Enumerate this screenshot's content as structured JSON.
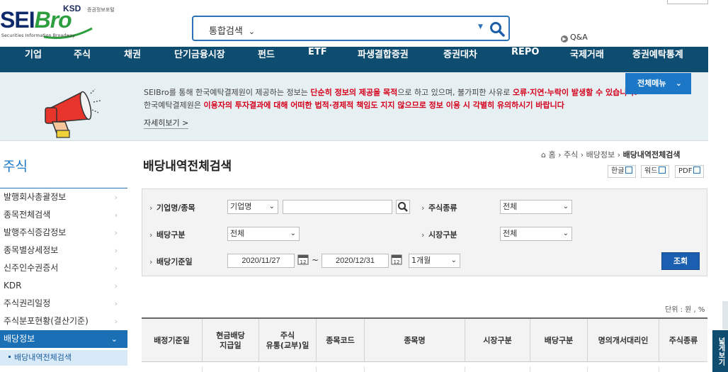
{
  "logo": {
    "brand_a": "SEI",
    "brand_b": "Bro",
    "ksd": "KSD",
    "ksd_sub": "증권정보포털",
    "tagline": "Securities Information Broadway"
  },
  "search": {
    "type_label": "통합검색",
    "value": "",
    "placeholder": ""
  },
  "qa_label": "Q&A",
  "nav": [
    "기업",
    "주식",
    "채권",
    "단기금융시장",
    "펀드",
    "ETF",
    "파생결합증권",
    "증권대차",
    "REPO",
    "국제거래",
    "증권예탁통계"
  ],
  "notice": {
    "line1_a": "SEIBro를 통해 한국예탁결제원이 제공하는 정보는 ",
    "line1_b": "단순히 정보의 제공을 목적",
    "line1_c": "으로 하고 있으며, 불가피한 사유로 ",
    "line1_d": "오류·지연·누락이 발생할 수 있습니다.",
    "line2_a": "한국예탁결제원은 ",
    "line2_b": "이용자의 투자결과에 대해 어떠한 법적·경제적 책임도 지지 않으므로 정보 이용 시 각별히 유의하시기 바랍니다",
    "more": "자세히보기 >"
  },
  "allmenu_label": "전체메뉴",
  "sidebar": {
    "title": "주식",
    "items": [
      "발행회사총괄정보",
      "종목전체검색",
      "발행주식증감정보",
      "종목별상세정보",
      "신주인수권증서",
      "KDR",
      "주식권리일정",
      "주식분포현황(결산기준)"
    ],
    "active": "배당정보",
    "sub": "배당내역전체검색"
  },
  "page": {
    "title": "배당내역전체검색",
    "breadcrumb": [
      "홈",
      "주식",
      "배당정보",
      "배당내역전체검색"
    ],
    "export": [
      "한글",
      "워드",
      "PDF"
    ]
  },
  "filters": {
    "company_label": "기업명/종목",
    "company_type": "기업명",
    "company_value": "",
    "stock_kind_label": "주식종류",
    "stock_kind": "전체",
    "div_type_label": "배당구분",
    "div_type": "전체",
    "market_label": "시장구분",
    "market": "전체",
    "date_label": "배당기준일",
    "date_from": "2020/11/27",
    "date_to": "2020/12/31",
    "period": "1개월",
    "submit": "조회"
  },
  "unit_text": "단위 : 원 , %",
  "table": {
    "headers": [
      "배정기준일",
      "현금배당\n지급일",
      "주식\n유통(교부)일",
      "종목코드",
      "종목명",
      "시장구분",
      "배당구분",
      "명의개서대리인",
      "주식종류"
    ]
  },
  "side_tab": "넓게보기",
  "colors": {
    "nav_bg": "#0e4c70",
    "accent": "#1c78c7",
    "warning": "#d6001c",
    "banner_bg": "#e6eff2"
  }
}
